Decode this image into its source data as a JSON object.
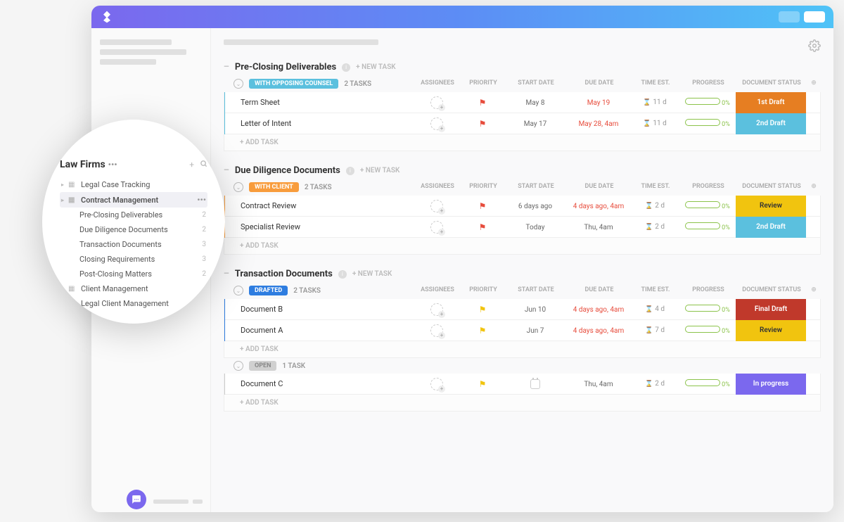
{
  "sidebar": {
    "title": "Law Firms",
    "items": [
      {
        "label": "Legal Case Tracking",
        "expandable": true
      },
      {
        "label": "Contract Management",
        "active": true,
        "children": [
          {
            "label": "Pre-Closing Deliverables",
            "count": 2
          },
          {
            "label": "Due Diligence Documents",
            "count": 2
          },
          {
            "label": "Transaction Documents",
            "count": 3
          },
          {
            "label": "Closing Requirements",
            "count": 3
          },
          {
            "label": "Post-Closing Matters",
            "count": 2
          }
        ]
      },
      {
        "label": "Client Management",
        "expandable": true
      },
      {
        "label": "Legal Client Management",
        "expandable": true
      }
    ]
  },
  "columns": {
    "assignees": "ASSIGNEES",
    "priority": "PRIORITY",
    "start": "START DATE",
    "due": "DUE DATE",
    "time": "TIME EST.",
    "progress": "PROGRESS",
    "doc": "DOCUMENT STATUS"
  },
  "labels": {
    "new_task": "+ NEW TASK",
    "add_task": "+ ADD TASK",
    "tasks_suffix": "TASKS",
    "task_suffix": "TASK",
    "progress_pct": "0%"
  },
  "groups": [
    {
      "title": "Pre-Closing Deliverables",
      "statuses": [
        {
          "name": "WITH OPPOSING COUNSEL",
          "color": "teal",
          "count": "2 TASKS",
          "tasks": [
            {
              "name": "Term Sheet",
              "flag": "red",
              "start": "May 8",
              "due": "May 19",
              "due_red": true,
              "time": "11 d",
              "doc": "1st Draft",
              "doc_color": "orange"
            },
            {
              "name": "Letter of Intent",
              "flag": "red",
              "start": "May 17",
              "due": "May 28, 4am",
              "due_red": true,
              "time": "11 d",
              "doc": "2nd Draft",
              "doc_color": "teal"
            }
          ]
        }
      ]
    },
    {
      "title": "Due Diligence Documents",
      "statuses": [
        {
          "name": "WITH CLIENT",
          "color": "orange",
          "count": "2 TASKS",
          "tasks": [
            {
              "name": "Contract Review",
              "flag": "red",
              "start": "6 days ago",
              "due": "4 days ago, 4am",
              "due_red": true,
              "time": "2 d",
              "doc": "Review",
              "doc_color": "yellow"
            },
            {
              "name": "Specialist Review",
              "flag": "red",
              "start": "Today",
              "due": "Thu, 4am",
              "due_red": false,
              "time": "2 d",
              "doc": "2nd Draft",
              "doc_color": "teal"
            }
          ]
        }
      ]
    },
    {
      "title": "Transaction Documents",
      "statuses": [
        {
          "name": "DRAFTED",
          "color": "blue",
          "count": "2 TASKS",
          "tasks": [
            {
              "name": "Document B",
              "flag": "yellow",
              "start": "Jun 10",
              "due": "4 days ago, 4am",
              "due_red": true,
              "time": "4 d",
              "doc": "Final Draft",
              "doc_color": "brick"
            },
            {
              "name": "Document A",
              "flag": "yellow",
              "start": "Jun 7",
              "due": "4 days ago, 4am",
              "due_red": true,
              "time": "7 d",
              "doc": "Review",
              "doc_color": "yellow"
            }
          ]
        },
        {
          "name": "OPEN",
          "color": "gray",
          "count": "1 TASK",
          "tasks": [
            {
              "name": "Document C",
              "flag": "yellow",
              "start": "",
              "start_cal": true,
              "due": "Thu, 4am",
              "due_red": false,
              "time": "2 d",
              "doc": "In progress",
              "doc_color": "purple"
            }
          ]
        }
      ]
    }
  ]
}
